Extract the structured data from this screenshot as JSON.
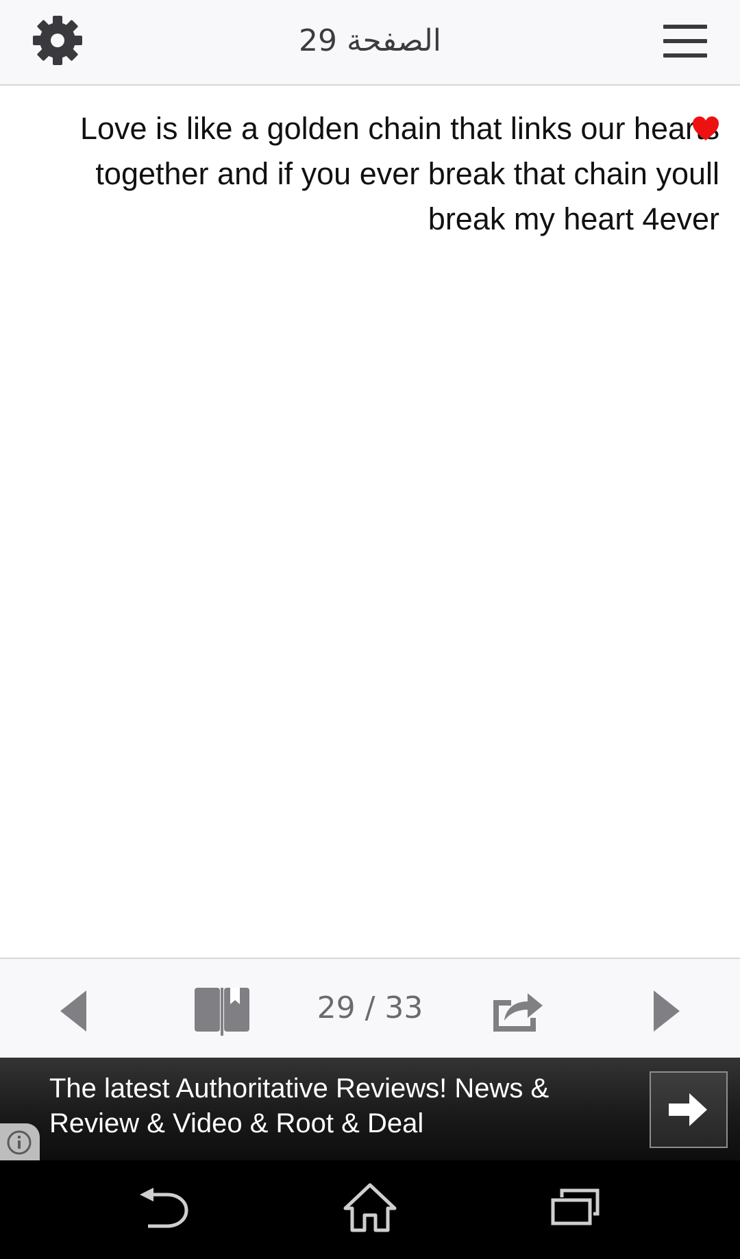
{
  "header": {
    "title": "الصفحة 29",
    "settings_icon": "gear-icon",
    "menu_icon": "hamburger-menu-icon"
  },
  "content": {
    "text": "Love is like a golden chain that links our hearts together and if you ever break that chain youll break my heart 4ever",
    "emoji_icon": "heart-icon",
    "emoji_color": "#ee1111"
  },
  "footer": {
    "counter": "29 / 33",
    "prev_icon": "chevron-left-icon",
    "bookmark_icon": "bookmark-book-icon",
    "share_icon": "share-icon",
    "next_icon": "chevron-right-icon",
    "icon_color": "#808084"
  },
  "ad": {
    "line1": "The latest Authoritative Reviews! News &",
    "line2": "Review & Video & Root & Deal",
    "arrow_icon": "arrow-right-icon",
    "info_icon": "info-icon"
  },
  "system_nav": {
    "back_icon": "back-icon",
    "home_icon": "home-icon",
    "recents_icon": "recent-apps-icon"
  }
}
